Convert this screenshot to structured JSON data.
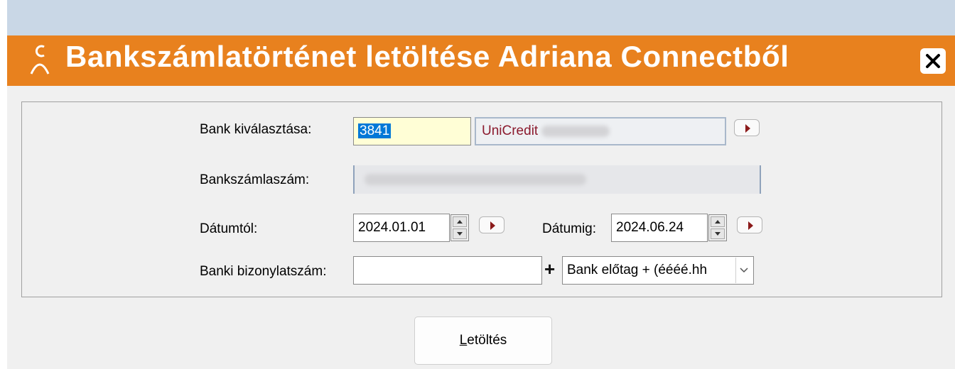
{
  "window": {
    "title": "Bankszámlatörténet letöltése Adriana Connectből",
    "close_icon": "close-icon",
    "logo_icon": "adriana-logo-icon",
    "title_bar_color": "#e8811e"
  },
  "form": {
    "bank_label": "Bank kiválasztása:",
    "bank_code": "3841",
    "bank_name": "UniCredit",
    "account_label": "Bankszámlaszám:",
    "date_from_label": "Dátumtól:",
    "date_from": "2024.01.01",
    "date_to_label": "Dátumig:",
    "date_to": "2024.06.24",
    "doc_number_label": "Banki bizonylatszám:",
    "doc_number_value": "",
    "plus_sign": "+",
    "doc_format_selected": "Bank előtag + (éééé.hh"
  },
  "actions": {
    "download_access_key": "L",
    "download_rest": "etöltés"
  }
}
